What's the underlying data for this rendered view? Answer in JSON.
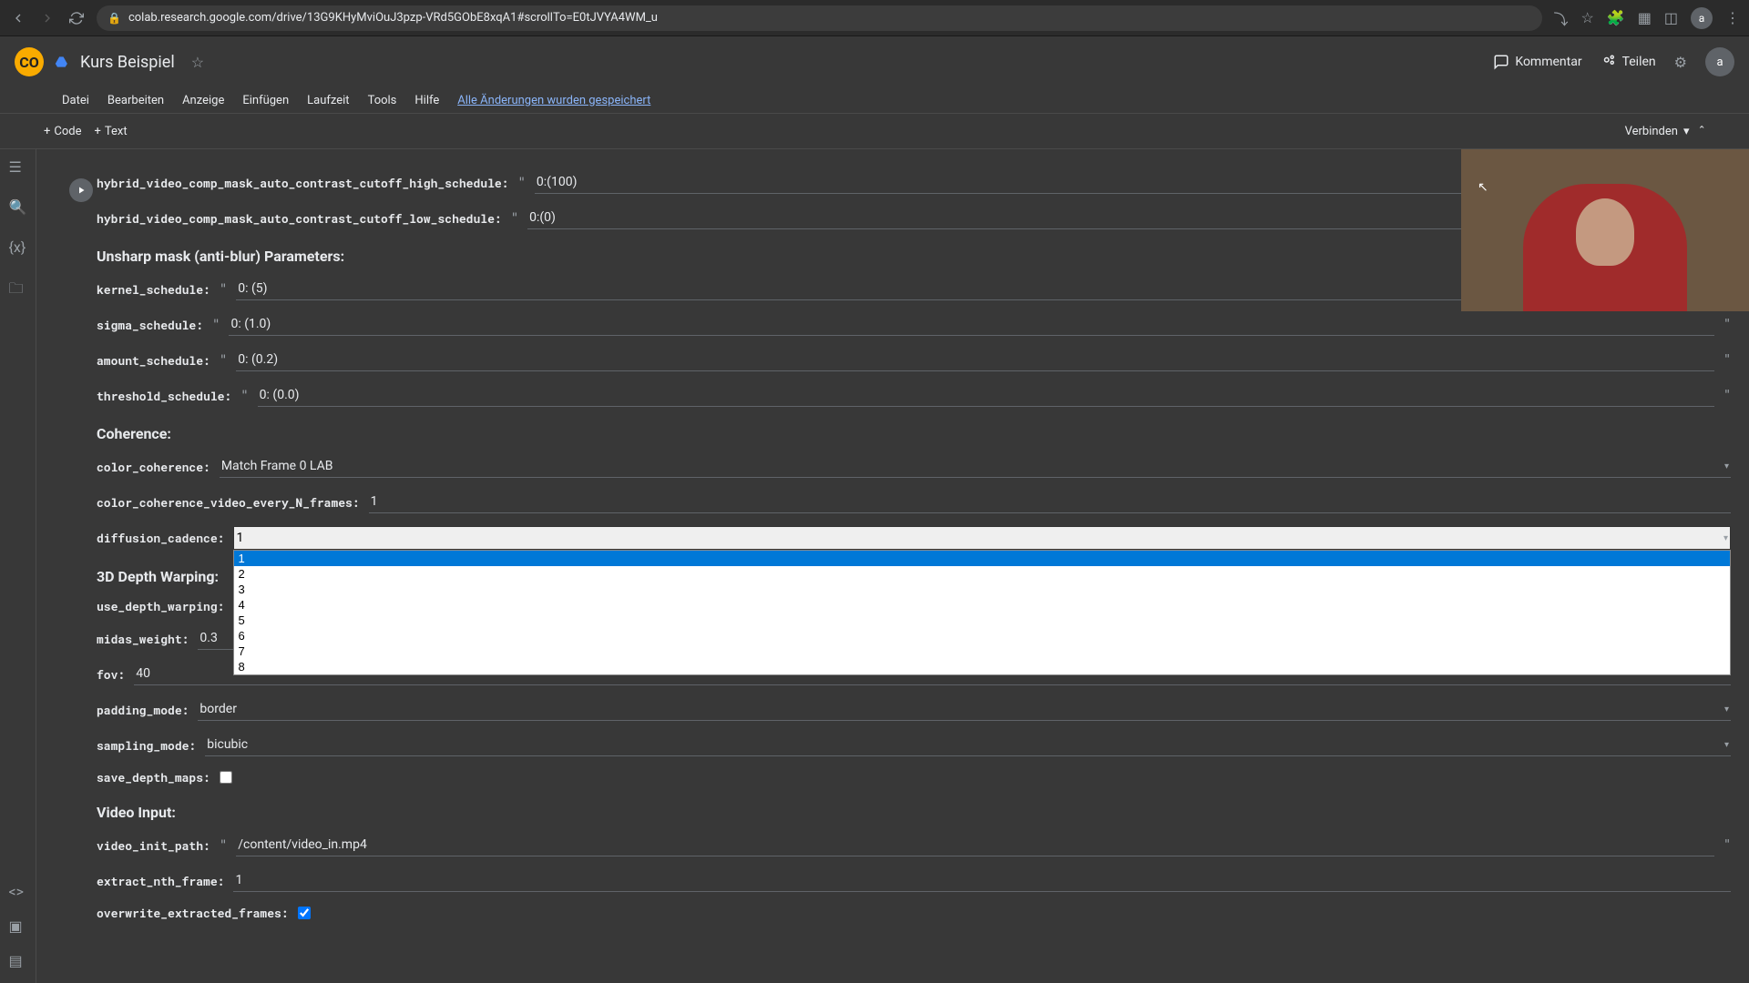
{
  "browser": {
    "url": "colab.research.google.com/drive/13G9KHyMviOuJ3pzp-VRd5GObE8xqA1#scrollTo=E0tJVYA4WM_u",
    "avatar": "a"
  },
  "header": {
    "title": "Kurs Beispiel",
    "kommentar": "Kommentar",
    "teilen": "Teilen",
    "avatar": "a"
  },
  "menu": {
    "items": [
      "Datei",
      "Bearbeiten",
      "Anzeige",
      "Einfügen",
      "Laufzeit",
      "Tools",
      "Hilfe"
    ],
    "saved": "Alle Änderungen wurden gespeichert"
  },
  "toolbar": {
    "code": "Code",
    "text": "Text",
    "verbinden": "Verbinden"
  },
  "form": {
    "hybrid_high": {
      "label": "hybrid_video_comp_mask_auto_contrast_cutoff_high_schedule:",
      "value": "0:(100)"
    },
    "hybrid_low": {
      "label": "hybrid_video_comp_mask_auto_contrast_cutoff_low_schedule:",
      "value": "0:(0)"
    },
    "sec_unsharp": "Unsharp mask (anti-blur) Parameters:",
    "kernel": {
      "label": "kernel_schedule:",
      "value": "0: (5)"
    },
    "sigma": {
      "label": "sigma_schedule:",
      "value": "0: (1.0)"
    },
    "amount": {
      "label": "amount_schedule:",
      "value": "0: (0.2)"
    },
    "threshold": {
      "label": "threshold_schedule:",
      "value": "0: (0.0)"
    },
    "sec_coherence": "Coherence:",
    "color_coherence": {
      "label": "color_coherence:",
      "value": "Match Frame 0 LAB"
    },
    "color_n": {
      "label": "color_coherence_video_every_N_frames:",
      "value": "1"
    },
    "diffusion": {
      "label": "diffusion_cadence:",
      "value": "1",
      "options": [
        "1",
        "2",
        "3",
        "4",
        "5",
        "6",
        "7",
        "8"
      ]
    },
    "sec_3d": "3D Depth Warping:",
    "use_depth": {
      "label": "use_depth_warping:"
    },
    "midas": {
      "label": "midas_weight:",
      "value": "0.3"
    },
    "fov": {
      "label": "fov:",
      "value": "40"
    },
    "padding": {
      "label": "padding_mode:",
      "value": "border"
    },
    "sampling": {
      "label": "sampling_mode:",
      "value": "bicubic"
    },
    "save_depth": {
      "label": "save_depth_maps:"
    },
    "sec_video": "Video Input:",
    "video_path": {
      "label": "video_init_path:",
      "value": "/content/video_in.mp4"
    },
    "extract_nth": {
      "label": "extract_nth_frame:",
      "value": "1"
    },
    "overwrite": {
      "label": "overwrite_extracted_frames:"
    }
  }
}
